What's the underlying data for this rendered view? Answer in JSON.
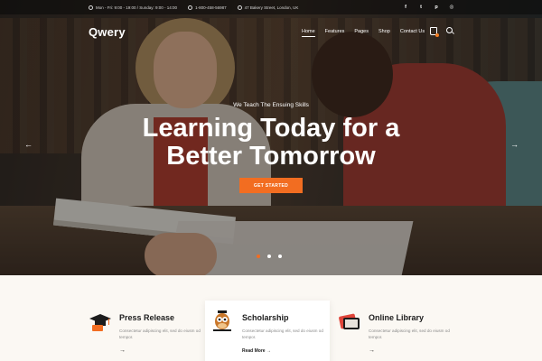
{
  "topbar": {
    "hours": "Mon - Fri: 9:00 - 19:00 / Sunday: 9:00 - 14:00",
    "phone": "1-800-458-56987",
    "address": "47 Bakery Street, London, UK",
    "social": [
      {
        "icon": "facebook-icon",
        "glyph": "f"
      },
      {
        "icon": "twitter-icon",
        "glyph": "t"
      },
      {
        "icon": "pinterest-icon",
        "glyph": "p"
      },
      {
        "icon": "instagram-icon",
        "glyph": "◎"
      }
    ]
  },
  "nav": {
    "logo": "Qwery",
    "items": [
      "Home",
      "Features",
      "Pages",
      "Shop",
      "Contact Us"
    ],
    "active": "Home"
  },
  "hero": {
    "eyebrow": "We Teach The Ensuing Skills",
    "headline_line1": "Learning Today for a",
    "headline_line2": "Better Tomorrow",
    "cta": "GET STARTED",
    "slides": 3,
    "active_slide": 1
  },
  "features": [
    {
      "icon": "graduation-cap-icon",
      "title": "Press Release",
      "desc": "Consectetur adipiscing elit, sed do eiusm od tempor.",
      "more": ""
    },
    {
      "icon": "owl-icon",
      "title": "Scholarship",
      "desc": "Consectetur adipiscing elit, sed do eiusm od tempor.",
      "more": "Read More →"
    },
    {
      "icon": "books-icon",
      "title": "Online Library",
      "desc": "Consectetur adipiscing elit, sed do eiusm od tempor.",
      "more": ""
    }
  ],
  "colors": {
    "accent": "#f26d21",
    "dark": "#1c1c1c",
    "bg": "#fbf8f3"
  }
}
